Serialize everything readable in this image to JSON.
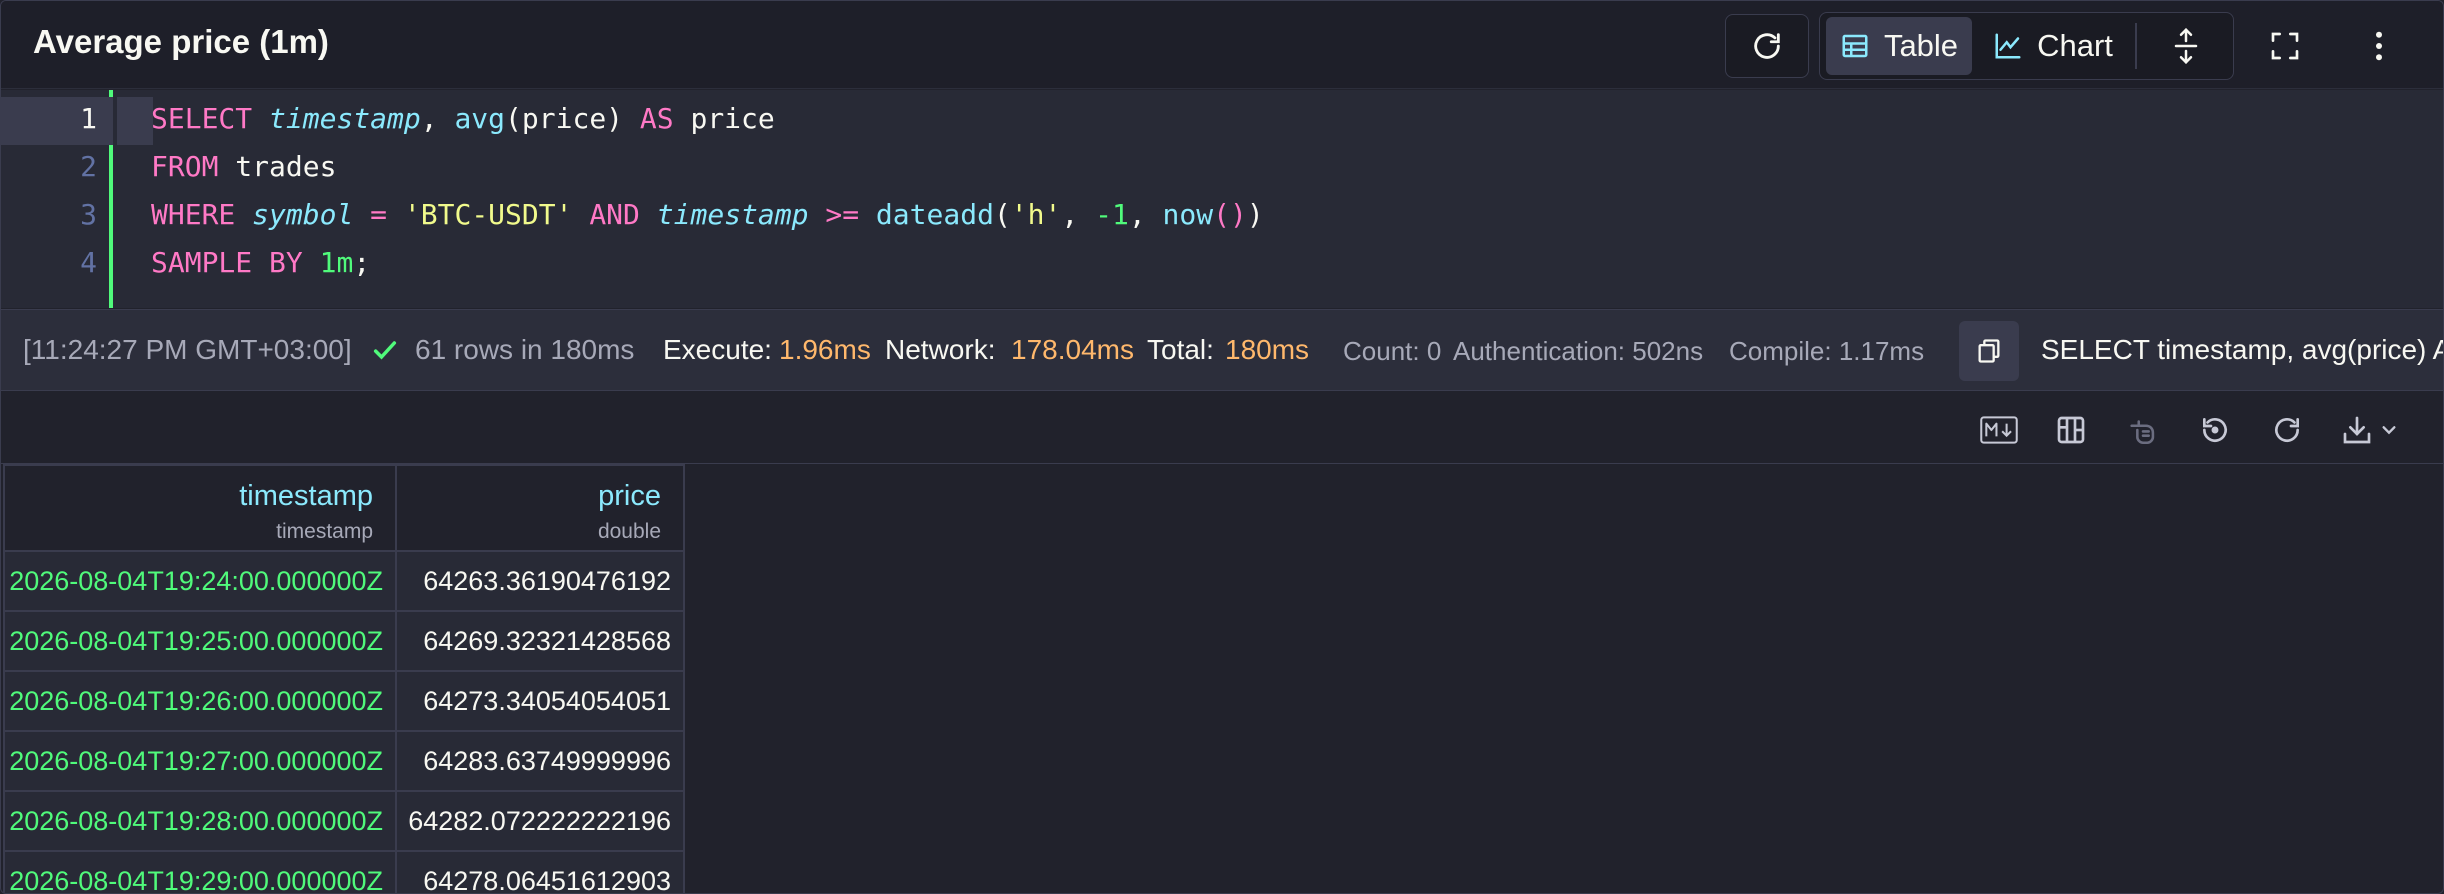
{
  "header": {
    "title": "Average price (1m)",
    "table_label": "Table",
    "chart_label": "Chart"
  },
  "editor": {
    "line_numbers": [
      "1",
      "2",
      "3",
      "4"
    ],
    "lines": [
      [
        {
          "t": "SELECT",
          "c": "kw"
        },
        {
          "t": " ",
          "c": ""
        },
        {
          "t": "timestamp",
          "c": "var"
        },
        {
          "t": ", ",
          "c": ""
        },
        {
          "t": "avg",
          "c": "fn"
        },
        {
          "t": "(price) ",
          "c": ""
        },
        {
          "t": "AS",
          "c": "kw"
        },
        {
          "t": " price",
          "c": ""
        }
      ],
      [
        {
          "t": "FROM",
          "c": "kw"
        },
        {
          "t": " trades",
          "c": ""
        }
      ],
      [
        {
          "t": "WHERE",
          "c": "kw"
        },
        {
          "t": " ",
          "c": ""
        },
        {
          "t": "symbol",
          "c": "var"
        },
        {
          "t": " ",
          "c": ""
        },
        {
          "t": "=",
          "c": "kw"
        },
        {
          "t": " ",
          "c": ""
        },
        {
          "t": "'BTC-USDT'",
          "c": "str"
        },
        {
          "t": " ",
          "c": ""
        },
        {
          "t": "AND",
          "c": "kw"
        },
        {
          "t": " ",
          "c": ""
        },
        {
          "t": "timestamp",
          "c": "var"
        },
        {
          "t": " ",
          "c": ""
        },
        {
          "t": ">=",
          "c": "kw"
        },
        {
          "t": " ",
          "c": ""
        },
        {
          "t": "dateadd",
          "c": "fn"
        },
        {
          "t": "(",
          "c": ""
        },
        {
          "t": "'h'",
          "c": "str"
        },
        {
          "t": ", ",
          "c": ""
        },
        {
          "t": "-1",
          "c": "num"
        },
        {
          "t": ", ",
          "c": ""
        },
        {
          "t": "now",
          "c": "fn"
        },
        {
          "t": "()",
          "c": "paren"
        },
        {
          "t": ")",
          "c": ""
        }
      ],
      [
        {
          "t": "SAMPLE",
          "c": "kw"
        },
        {
          "t": " ",
          "c": ""
        },
        {
          "t": "BY",
          "c": "kw"
        },
        {
          "t": " ",
          "c": ""
        },
        {
          "t": "1m",
          "c": "num"
        },
        {
          "t": ";",
          "c": ""
        }
      ]
    ]
  },
  "status": {
    "time": "[11:24:27 PM GMT+03:00]",
    "rows_text": "61 rows in 180ms",
    "execute_label": "Execute:",
    "execute_value": "1.96ms",
    "network_label": "Network:",
    "network_value": "178.04ms",
    "total_label": "Total:",
    "total_value": "180ms",
    "count_text": "Count: 0",
    "auth_text": "Authentication: 502ns",
    "compile_text": "Compile: 1.17ms",
    "query_preview": "SELECT timestamp, avg(price) AS price"
  },
  "table": {
    "columns": [
      {
        "name": "timestamp",
        "type": "timestamp"
      },
      {
        "name": "price",
        "type": "double"
      }
    ],
    "rows": [
      [
        "2026-08-04T19:24:00.000000Z",
        "64263.36190476192"
      ],
      [
        "2026-08-04T19:25:00.000000Z",
        "64269.32321428568"
      ],
      [
        "2026-08-04T19:26:00.000000Z",
        "64273.34054054051"
      ],
      [
        "2026-08-04T19:27:00.000000Z",
        "64283.63749999996"
      ],
      [
        "2026-08-04T19:28:00.000000Z",
        "64282.072222222196"
      ],
      [
        "2026-08-04T19:29:00.000000Z",
        "64278.06451612903"
      ]
    ]
  },
  "colors": {
    "accent_green": "#50fa7b",
    "accent_cyan": "#8be9fd",
    "accent_pink": "#ff79c6",
    "accent_orange": "#ffb86c"
  },
  "icons": [
    "refresh-icon",
    "table-icon",
    "chart-icon",
    "expand-vertical-icon",
    "fullscreen-icon",
    "more-vertical-icon",
    "check-icon",
    "copy-icon",
    "markdown-icon",
    "columns-icon",
    "freeze-icon",
    "reset-icon",
    "reload-icon",
    "download-icon",
    "chevron-down-icon"
  ]
}
